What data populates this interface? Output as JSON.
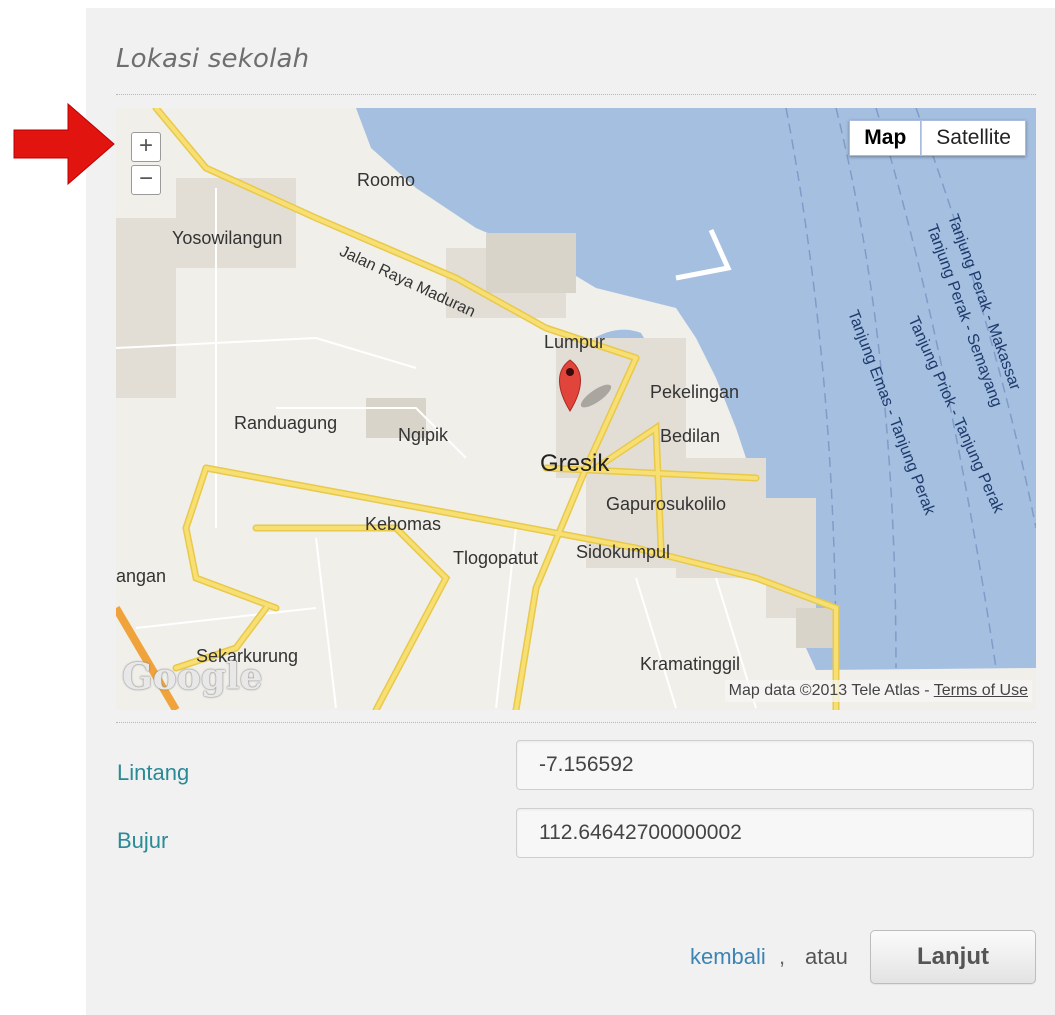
{
  "section": {
    "title": "Lokasi sekolah"
  },
  "map": {
    "type_buttons": [
      "Map",
      "Satellite"
    ],
    "active_type": "Map",
    "zoom_in": "+",
    "zoom_out": "−",
    "labels": {
      "roomo": "Roomo",
      "yosowilangun": "Yosowilangun",
      "road_main": "Jalan Raya Maduran",
      "lumpur": "Lumpur",
      "pekelingan": "Pekelingan",
      "randuagung": "Randuagung",
      "ngipik": "Ngipik",
      "bedilan": "Bedilan",
      "gresik": "Gresik",
      "gapurosukolilo": "Gapurosukolilo",
      "kebomas": "Kebomas",
      "tlogopatut": "Tlogopatut",
      "sidokumpul": "Sidokumpul",
      "angan": "angan",
      "sekarkurung": "Sekarkurung",
      "kramatinggil": "Kramatinggil"
    },
    "shipping_lanes": [
      "Tanjung Perak - Makassar",
      "Tanjung Perak - Semayang",
      "Tanjung Priok - Tanjung Perak",
      "Tanjung Emas - Tanjung Perak"
    ],
    "logo": "Google",
    "attribution": "Map data ©2013 Tele Atlas - ",
    "terms_link": "Terms of Use",
    "colors": {
      "water": "#a4bfdf",
      "land": "#f1efea",
      "road": "#f7df74",
      "marker": "#e0443a"
    }
  },
  "form": {
    "lat_label": "Lintang",
    "lat_value": "-7.156592",
    "lng_label": "Bujur",
    "lng_value": "112.64642700000002"
  },
  "footer": {
    "back_link": "kembali",
    "separator": ",",
    "or_text": "atau",
    "next_button": "Lanjut"
  }
}
